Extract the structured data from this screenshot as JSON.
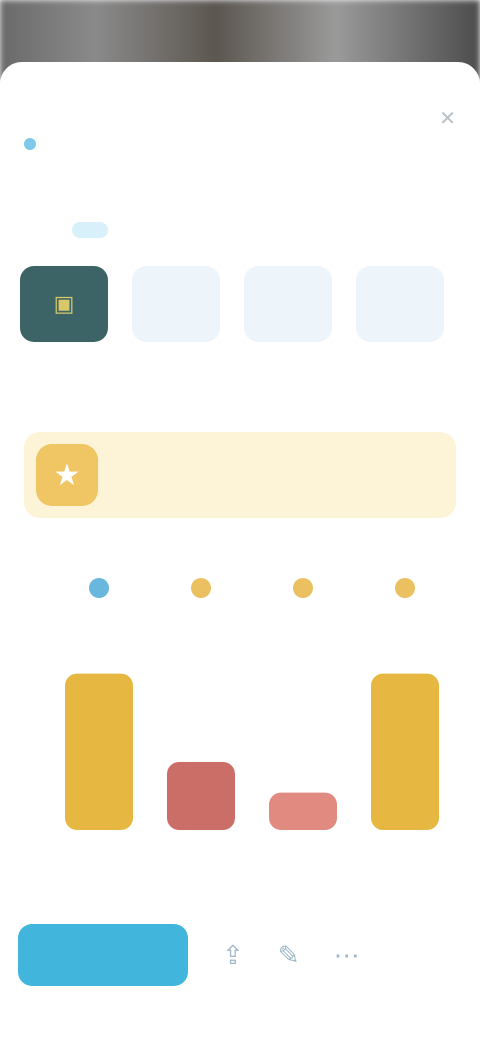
{
  "header": {
    "title": "",
    "subtitle": ""
  },
  "tabs": [
    {
      "label": "",
      "active": false
    },
    {
      "label": "",
      "active": false
    },
    {
      "label": "",
      "active": true
    },
    {
      "label": "",
      "active": false
    },
    {
      "label": "",
      "active": false
    }
  ],
  "thumbnails": [
    {
      "icon": "folder-icon",
      "active": true
    },
    {
      "icon": "image-icon",
      "active": false
    },
    {
      "icon": "image-icon",
      "active": false
    },
    {
      "icon": "image-icon",
      "active": false
    },
    {
      "icon": "image-icon",
      "active": false
    }
  ],
  "section": {
    "label": ""
  },
  "banner": {
    "text": "",
    "icon": "star-icon",
    "color": "#f0c564"
  },
  "chart_data": {
    "type": "bar",
    "categories": [
      "",
      "",
      "",
      ""
    ],
    "values": [
      0.92,
      0.4,
      0.22,
      0.92
    ],
    "bar_colors": [
      "#e6b741",
      "#cc6e68",
      "#e08a80",
      "#e6b741"
    ],
    "marker_colors": [
      "#6ab7dd",
      "#eac060",
      "#eac060",
      "#eac060"
    ],
    "ylim": [
      0,
      1
    ]
  },
  "bottom_bar": {
    "primary_label": "",
    "primary_color": "#42b5dc",
    "icons": [
      "share-icon",
      "edit-icon",
      "more-icon"
    ]
  }
}
